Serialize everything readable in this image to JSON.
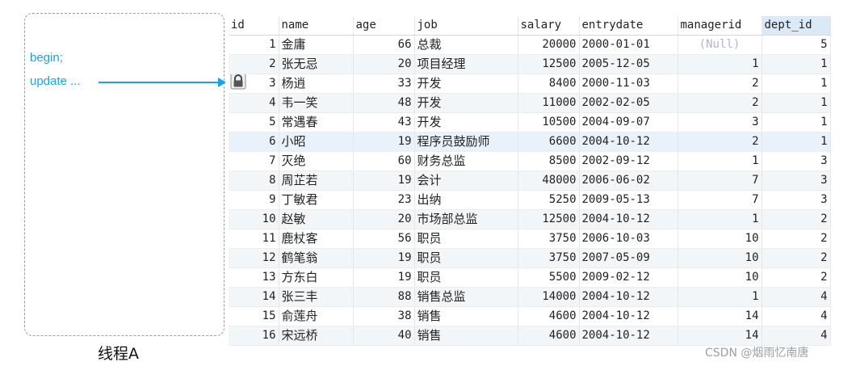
{
  "thread": {
    "line1": "begin;",
    "line2": "update ...",
    "label": "线程A"
  },
  "table": {
    "columns": [
      "id",
      "name",
      "age",
      "job",
      "salary",
      "entrydate",
      "managerid",
      "dept_id"
    ],
    "rows": [
      {
        "id": "1",
        "name": "金庸",
        "age": "66",
        "job": "总裁",
        "salary": "20000",
        "entrydate": "2000-01-01",
        "managerid": "(Null)",
        "dept_id": "5"
      },
      {
        "id": "2",
        "name": "张无忌",
        "age": "20",
        "job": "项目经理",
        "salary": "12500",
        "entrydate": "2005-12-05",
        "managerid": "1",
        "dept_id": "1"
      },
      {
        "id": "3",
        "name": "杨逍",
        "age": "33",
        "job": "开发",
        "salary": "8400",
        "entrydate": "2000-11-03",
        "managerid": "2",
        "dept_id": "1"
      },
      {
        "id": "4",
        "name": "韦一笑",
        "age": "48",
        "job": "开发",
        "salary": "11000",
        "entrydate": "2002-02-05",
        "managerid": "2",
        "dept_id": "1"
      },
      {
        "id": "5",
        "name": "常遇春",
        "age": "43",
        "job": "开发",
        "salary": "10500",
        "entrydate": "2004-09-07",
        "managerid": "3",
        "dept_id": "1"
      },
      {
        "id": "6",
        "name": "小昭",
        "age": "19",
        "job": "程序员鼓励师",
        "salary": "6600",
        "entrydate": "2004-10-12",
        "managerid": "2",
        "dept_id": "1"
      },
      {
        "id": "7",
        "name": "灭绝",
        "age": "60",
        "job": "财务总监",
        "salary": "8500",
        "entrydate": "2002-09-12",
        "managerid": "1",
        "dept_id": "3"
      },
      {
        "id": "8",
        "name": "周芷若",
        "age": "19",
        "job": "会计",
        "salary": "48000",
        "entrydate": "2006-06-02",
        "managerid": "7",
        "dept_id": "3"
      },
      {
        "id": "9",
        "name": "丁敏君",
        "age": "23",
        "job": "出纳",
        "salary": "5250",
        "entrydate": "2009-05-13",
        "managerid": "7",
        "dept_id": "3"
      },
      {
        "id": "10",
        "name": "赵敏",
        "age": "20",
        "job": "市场部总监",
        "salary": "12500",
        "entrydate": "2004-10-12",
        "managerid": "1",
        "dept_id": "2"
      },
      {
        "id": "11",
        "name": "鹿杖客",
        "age": "56",
        "job": "职员",
        "salary": "3750",
        "entrydate": "2006-10-03",
        "managerid": "10",
        "dept_id": "2"
      },
      {
        "id": "12",
        "name": "鹤笔翁",
        "age": "19",
        "job": "职员",
        "salary": "3750",
        "entrydate": "2007-05-09",
        "managerid": "10",
        "dept_id": "2"
      },
      {
        "id": "13",
        "name": "方东白",
        "age": "19",
        "job": "职员",
        "salary": "5500",
        "entrydate": "2009-02-12",
        "managerid": "10",
        "dept_id": "2"
      },
      {
        "id": "14",
        "name": "张三丰",
        "age": "88",
        "job": "销售总监",
        "salary": "14000",
        "entrydate": "2004-10-12",
        "managerid": "1",
        "dept_id": "4"
      },
      {
        "id": "15",
        "name": "俞莲舟",
        "age": "38",
        "job": "销售",
        "salary": "4600",
        "entrydate": "2004-10-12",
        "managerid": "14",
        "dept_id": "4"
      },
      {
        "id": "16",
        "name": "宋远桥",
        "age": "40",
        "job": "销售",
        "salary": "4600",
        "entrydate": "2004-10-12",
        "managerid": "14",
        "dept_id": "4"
      }
    ]
  },
  "watermark": "CSDN @烟雨忆南唐",
  "colors": {
    "accent": "#1aa3e8",
    "selected_header": "#dbe9f7",
    "null_text": "#b0b8c4"
  },
  "icons": {
    "row_lock": "lock-icon"
  }
}
